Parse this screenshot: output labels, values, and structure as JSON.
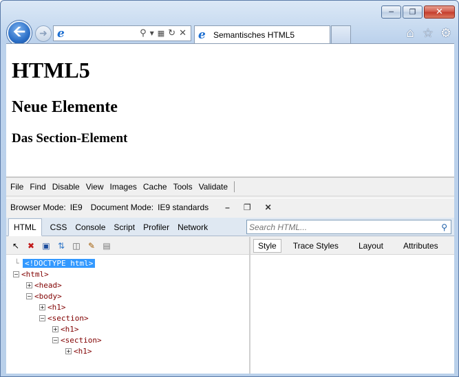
{
  "browser": {
    "tab_title": "Semantisches HTML5",
    "address_value": ""
  },
  "page": {
    "h1": "HTML5",
    "h2": "Neue Elemente",
    "h3": "Das Section-Element"
  },
  "devtools": {
    "menu": [
      "File",
      "Find",
      "Disable",
      "View",
      "Images",
      "Cache",
      "Tools",
      "Validate"
    ],
    "browser_mode_label": "Browser Mode:",
    "browser_mode_value": "IE9",
    "document_mode_label": "Document Mode:",
    "document_mode_value": "IE9 standards",
    "tabs": [
      "HTML",
      "CSS",
      "Console",
      "Script",
      "Profiler",
      "Network"
    ],
    "search_placeholder": "Search HTML...",
    "right_tabs": [
      "Style",
      "Trace Styles",
      "Layout",
      "Attributes"
    ],
    "tree": [
      {
        "label": "<!DOCTYPE html>",
        "indent": 0,
        "expander": "none"
      },
      {
        "label": "<html>",
        "indent": 0,
        "expander": "minus"
      },
      {
        "label": "<head>",
        "indent": 1,
        "expander": "plus"
      },
      {
        "label": "<body>",
        "indent": 1,
        "expander": "minus"
      },
      {
        "label": "<h1>",
        "indent": 2,
        "expander": "plus"
      },
      {
        "label": "<section>",
        "indent": 2,
        "expander": "minus"
      },
      {
        "label": "<h1>",
        "indent": 3,
        "expander": "plus"
      },
      {
        "label": "<section>",
        "indent": 3,
        "expander": "minus"
      },
      {
        "label": "<h1>",
        "indent": 4,
        "expander": "plus"
      }
    ]
  }
}
